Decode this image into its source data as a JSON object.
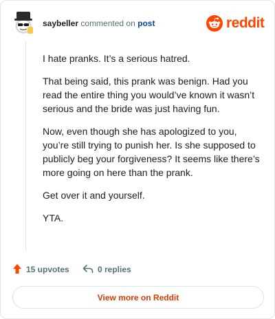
{
  "colors": {
    "brand": "#ff4500",
    "link": "#0a449b",
    "muted": "#576f76",
    "cta": "#d93a00"
  },
  "header": {
    "username": "saybeller",
    "action": "commented on",
    "target": "post",
    "brand_text": "reddit",
    "avatar_icon": "snoo-avatar-icon",
    "brand_icon": "reddit-logo-icon"
  },
  "comment": {
    "paragraphs": [
      "I hate pranks. It’s a serious hatred.",
      "That being said, this prank was benign. Had you read the entire thing you would’ve known it wasn’t serious and the bride was just having fun.",
      "Now, even though she has apologized to you, you’re still trying to punish her. Is she supposed to publicly beg your forgiveness? It seems like there’s more going on here than the prank.",
      "Get over it and yourself.",
      "YTA."
    ]
  },
  "footer": {
    "upvotes_label": "15 upvotes",
    "replies_label": "0 replies",
    "upvote_icon": "upvote-arrow-icon",
    "reply_icon": "reply-arrow-icon"
  },
  "cta": {
    "label": "View more on Reddit"
  }
}
